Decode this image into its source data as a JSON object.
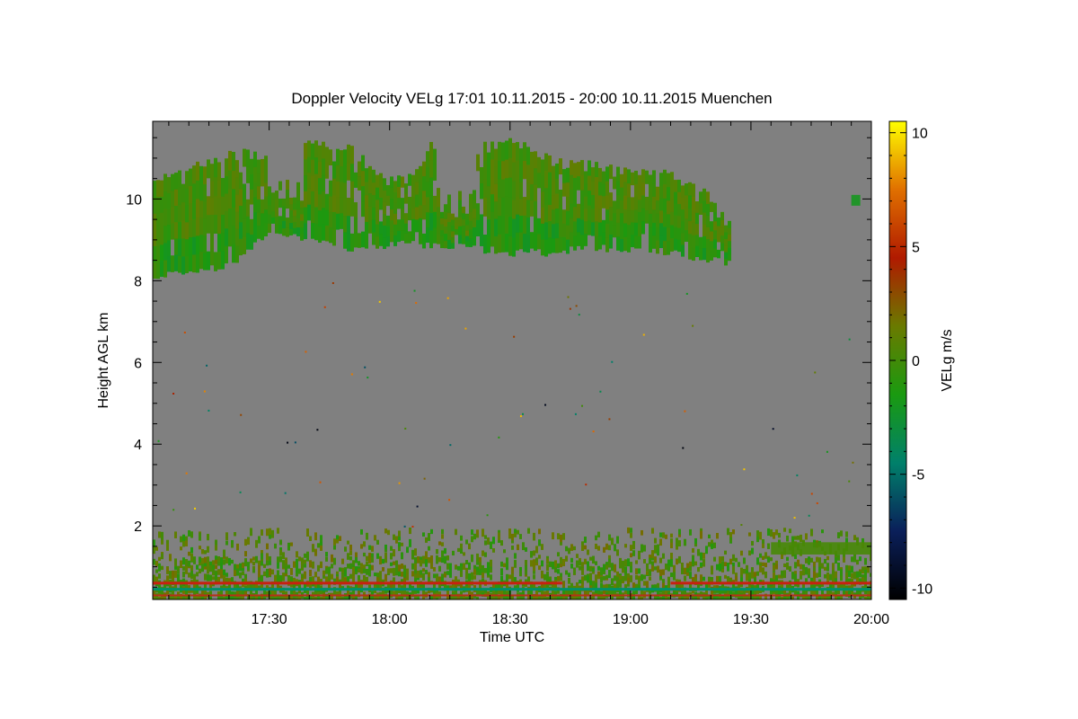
{
  "chart_data": {
    "type": "heatmap",
    "title": "Doppler Velocity VELg   17:01 10.11.2015 - 20:00 10.11.2015 Muenchen",
    "xlabel": "Time UTC",
    "ylabel": "Height AGL km",
    "xlim": [
      "17:01",
      "20:00"
    ],
    "ylim": [
      0.2,
      11.9
    ],
    "x_ticks": [
      "17:30",
      "18:00",
      "18:30",
      "19:00",
      "19:30",
      "20:00"
    ],
    "y_ticks": [
      "2",
      "4",
      "6",
      "8",
      "10"
    ],
    "colorbar": {
      "label": "VELg m/s",
      "ticks": [
        "10",
        "5",
        "0",
        "-5",
        "-10"
      ],
      "range": [
        -10.5,
        10.5
      ],
      "colors": [
        "#000000",
        "#0a1f5a",
        "#00806a",
        "#1a9a10",
        "#6a7a00",
        "#b01a00",
        "#e07000",
        "#ffff00"
      ]
    },
    "background_color": "#808080",
    "cloud_layer": {
      "description_values": "velocity mostly -2 to 1 m/s",
      "time_extent": [
        "17:01",
        "19:25"
      ],
      "top_km_at": [
        {
          "t": "17:01",
          "h": 10.4
        },
        {
          "t": "17:10",
          "h": 10.8
        },
        {
          "t": "17:20",
          "h": 11.1
        },
        {
          "t": "17:30",
          "h": 11.1
        },
        {
          "t": "17:40",
          "h": 11.3
        },
        {
          "t": "17:50",
          "h": 11.2
        },
        {
          "t": "18:00",
          "h": 10.4
        },
        {
          "t": "18:05",
          "h": 10.5
        },
        {
          "t": "18:10",
          "h": 11.3
        },
        {
          "t": "18:20",
          "h": 11.2
        },
        {
          "t": "18:30",
          "h": 11.4
        },
        {
          "t": "18:40",
          "h": 10.9
        },
        {
          "t": "18:50",
          "h": 10.8
        },
        {
          "t": "19:00",
          "h": 10.6
        },
        {
          "t": "19:10",
          "h": 10.6
        },
        {
          "t": "19:20",
          "h": 10.0
        },
        {
          "t": "19:25",
          "h": 9.2
        }
      ],
      "base_km_at": [
        {
          "t": "17:01",
          "h": 8.1
        },
        {
          "t": "17:10",
          "h": 8.2
        },
        {
          "t": "17:20",
          "h": 8.4
        },
        {
          "t": "17:30",
          "h": 9.2
        },
        {
          "t": "17:40",
          "h": 9.0
        },
        {
          "t": "17:50",
          "h": 8.8
        },
        {
          "t": "18:00",
          "h": 8.9
        },
        {
          "t": "18:10",
          "h": 8.9
        },
        {
          "t": "18:20",
          "h": 8.8
        },
        {
          "t": "18:30",
          "h": 8.7
        },
        {
          "t": "18:40",
          "h": 8.7
        },
        {
          "t": "18:50",
          "h": 8.8
        },
        {
          "t": "19:00",
          "h": 8.8
        },
        {
          "t": "19:10",
          "h": 8.7
        },
        {
          "t": "19:20",
          "h": 8.5
        },
        {
          "t": "19:25",
          "h": 8.4
        }
      ]
    },
    "boundary_layer": {
      "description_values": "velocity mostly -1 to 2 m/s",
      "time_extent": [
        "17:01",
        "20:00"
      ],
      "top_km": 1.9,
      "dense_top_km": 1.2,
      "red_line_km": 0.6,
      "green_line_km": 0.45,
      "red_line2_km": 0.3,
      "late_layer": {
        "time_extent": [
          "19:35",
          "20:00"
        ],
        "height_km": [
          1.3,
          1.6
        ]
      }
    }
  }
}
